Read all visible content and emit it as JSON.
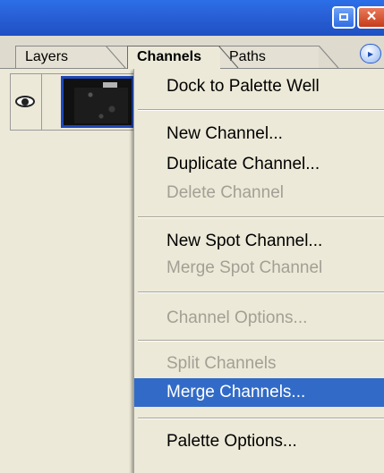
{
  "window": {
    "close_glyph": "×"
  },
  "tabs": [
    {
      "label": "Layers"
    },
    {
      "label": "Channels"
    },
    {
      "label": "Paths"
    }
  ],
  "active_tab": "Channels",
  "palette_menu_arrow": "▸",
  "menu": {
    "items": [
      {
        "label": "Dock to Palette Well",
        "enabled": true
      },
      {
        "label": "New Channel...",
        "enabled": true
      },
      {
        "label": "Duplicate Channel...",
        "enabled": true
      },
      {
        "label": "Delete Channel",
        "enabled": false
      },
      {
        "label": "New Spot Channel...",
        "enabled": true
      },
      {
        "label": "Merge Spot Channel",
        "enabled": false
      },
      {
        "label": "Channel Options...",
        "enabled": false
      },
      {
        "label": "Split Channels",
        "enabled": false
      },
      {
        "label": "Merge Channels...",
        "enabled": true,
        "highlighted": true
      },
      {
        "label": "Palette Options...",
        "enabled": true
      }
    ]
  },
  "colors": {
    "titlebar": "#2a61d8",
    "highlight": "#326bc7",
    "disabled_text": "#a39f94",
    "panel_bg": "#ece9d8"
  }
}
